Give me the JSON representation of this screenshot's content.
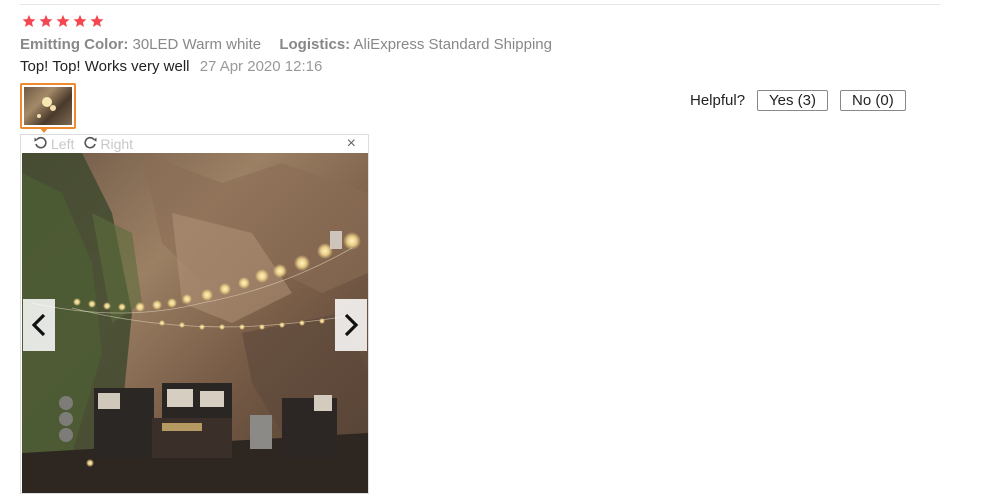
{
  "review": {
    "rating": 5,
    "star_color": "#f5474f",
    "attributes": [
      {
        "label": "Emitting Color:",
        "value": "30LED Warm white"
      },
      {
        "label": "Logistics:",
        "value": "AliExpress Standard Shipping"
      }
    ],
    "text": "Top! Top! Works very well",
    "date": "27 Apr 2020 12:16"
  },
  "helpful": {
    "label": "Helpful?",
    "yes_label": "Yes (3)",
    "no_label": "No (0)"
  },
  "viewer": {
    "rotate_left_label": "Left",
    "rotate_right_label": "Right",
    "close_label": "×",
    "thumbnail_border_color": "#f08a2f",
    "icons": [
      "rotate-left-icon",
      "rotate-right-icon",
      "close-icon",
      "chevron-left-icon",
      "chevron-right-icon",
      "star-icon"
    ]
  }
}
